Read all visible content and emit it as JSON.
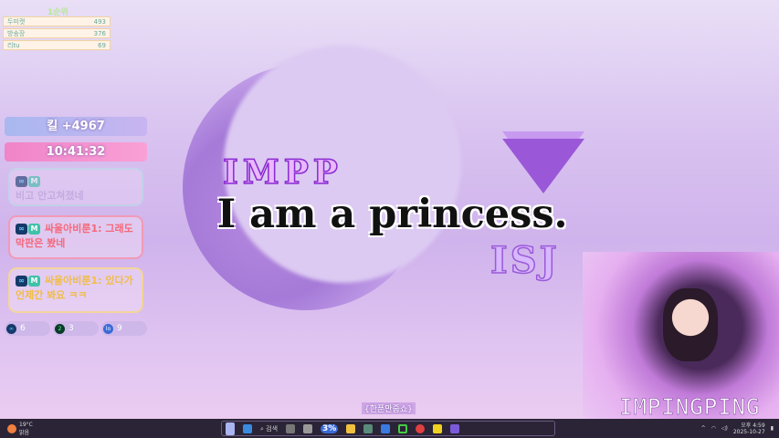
{
  "ranking": {
    "title": "1순위",
    "rows": [
      {
        "name": "두미캣",
        "value": "493"
      },
      {
        "name": "방송장",
        "value": "376"
      },
      {
        "name": "리tu",
        "value": "69"
      }
    ]
  },
  "kill": "킬 +4967",
  "clock": "10:41:32",
  "chats": [
    {
      "text": "비고 안고쳐졌네",
      "badges": [
        "∞",
        "M"
      ],
      "faded": true
    },
    {
      "user": "싸울아비룬1",
      "text": "그래도 막판은 봤네",
      "badges": [
        "∞",
        "M"
      ]
    },
    {
      "user": "싸울아비룬1",
      "text": "있다가 언제간 봐요 ㅋㅋ",
      "badges": [
        "∞",
        "M"
      ]
    }
  ],
  "counts": [
    {
      "icon": "∞",
      "value": "6"
    },
    {
      "icon": "2",
      "value": "3"
    },
    {
      "icon": "lo",
      "value": "9"
    }
  ],
  "titles": {
    "line1": "IMPP",
    "line2": "I am a princess.",
    "line3": "ISJ"
  },
  "cam_label": "IMPINGPING",
  "subtitle": "{한푼만줍쇼}",
  "taskbar": {
    "weather_temp": "19°C",
    "weather_desc": "맑음",
    "search": "검색",
    "badge": "3%",
    "time": "오후 4:59",
    "date": "2025-10-27"
  }
}
